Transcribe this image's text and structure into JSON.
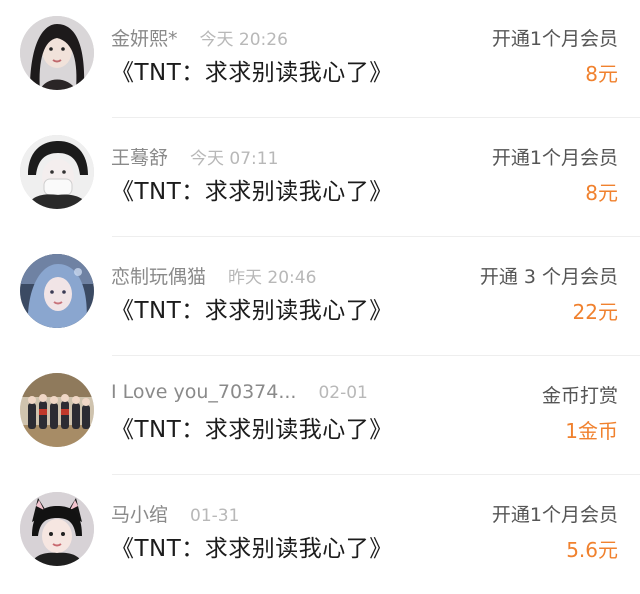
{
  "accent_color": "#f0812e",
  "rows": [
    {
      "avatar_icon": "user-avatar-icon",
      "username": "金妍熙*",
      "timestamp": "今天 20:26",
      "title": "《TNT：求求别读我心了》",
      "action": "开通1个月会员",
      "amount": "8元"
    },
    {
      "avatar_icon": "user-avatar-icon",
      "username": "王蓦舒",
      "timestamp": "今天 07:11",
      "title": "《TNT：求求别读我心了》",
      "action": "开通1个月会员",
      "amount": "8元"
    },
    {
      "avatar_icon": "user-avatar-icon",
      "username": "恋制玩偶猫",
      "timestamp": "昨天 20:46",
      "title": "《TNT：求求别读我心了》",
      "action": "开通 3 个月会员",
      "amount": "22元"
    },
    {
      "avatar_icon": "user-avatar-icon",
      "username": "I Love you_70374...",
      "timestamp": "02-01",
      "title": "《TNT：求求别读我心了》",
      "action": "金币打赏",
      "amount": "1金币"
    },
    {
      "avatar_icon": "user-avatar-icon",
      "username": "马小绾",
      "timestamp": "01-31",
      "title": "《TNT：求求别读我心了》",
      "action": "开通1个月会员",
      "amount": "5.6元"
    }
  ]
}
